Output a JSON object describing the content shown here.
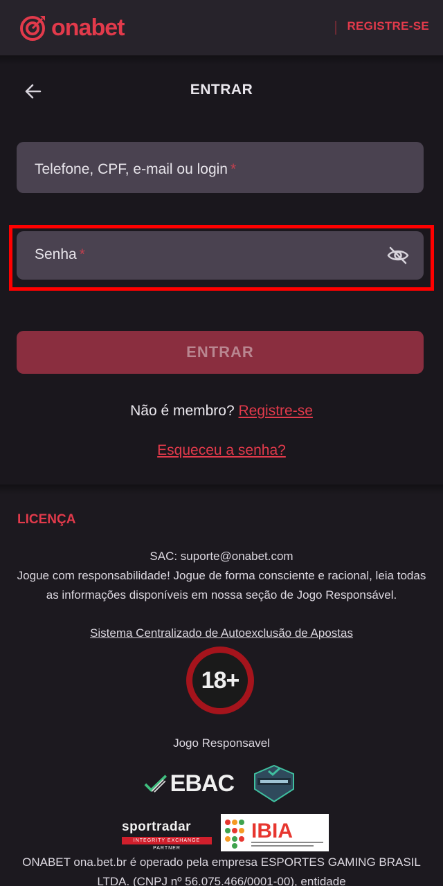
{
  "header": {
    "logo_text": "onabet",
    "register_label": "REGISTRE-SE"
  },
  "login": {
    "title": "ENTRAR",
    "login_field_label": "Telefone, CPF, e-mail ou login",
    "password_field_label": "Senha",
    "required_mark": "*",
    "submit_label": "ENTRAR",
    "not_member_text": "Não é membro?",
    "register_link": "Registre-se",
    "forgot_link": "Esqueceu a senha?"
  },
  "footer": {
    "license_heading": "LICENÇA",
    "sac": "SAC: suporte@onabet.com",
    "responsibility": "Jogue com responsabilidade! Jogue de forma consciente e racional, leia todas as informações disponíveis em nossa seção de Jogo Responsável.",
    "self_exclusion_link": "Sistema Centralizado de Autoexclusão de Apostas",
    "age_badge": "18+",
    "responsible_gaming": "Jogo Responsavel",
    "ebac_text": "EBAC",
    "sportradar_text": "sportradar",
    "sportradar_tagline": "INTEGRITY EXCHANGE PARTNER",
    "ibia_text": "IBIA",
    "operator_text": "ONABET ona.bet.br é operado pela empresa ESPORTES GAMING BRASIL LTDA. (CNPJ nº 56.075.466/0001-00), entidade"
  },
  "colors": {
    "brand_red": "#e23a4b",
    "highlight": "#ff0000",
    "field_bg": "#4a4250",
    "button_bg": "#8a2e3f"
  }
}
